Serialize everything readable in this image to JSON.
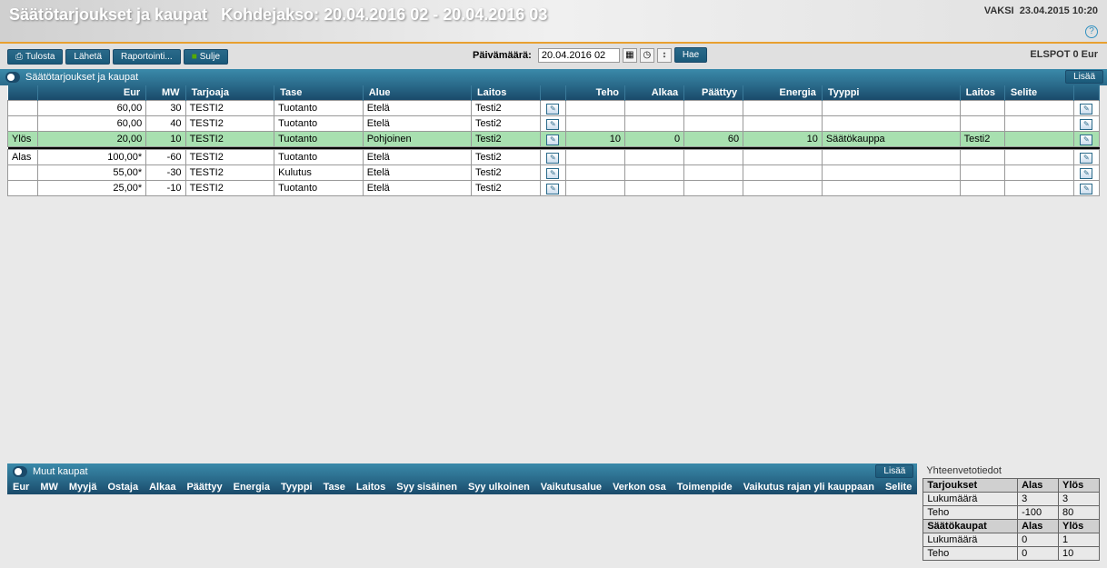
{
  "header": {
    "title": "Säätötarjoukset ja kaupat",
    "period_label": "Kohdejakso: 20.04.2016 02 - 20.04.2016 03",
    "app_label": "VAKSI",
    "timestamp": "23.04.2015 10:20"
  },
  "toolbar": {
    "print": "Tulosta",
    "send": "Lähetä",
    "report": "Raportointi...",
    "close": "Sulje",
    "date_label": "Päivämäärä:",
    "date_value": "20.04.2016 02",
    "search": "Hae",
    "elspot": "ELSPOT 0 Eur"
  },
  "panel1": {
    "title": "Säätötarjoukset ja kaupat",
    "add": "Lisää",
    "columns": [
      "",
      "Eur",
      "MW",
      "Tarjoaja",
      "Tase",
      "Alue",
      "Laitos",
      "",
      "Teho",
      "Alkaa",
      "Päättyy",
      "Energia",
      "Tyyppi",
      "Laitos",
      "Selite",
      ""
    ],
    "rows": [
      {
        "c0": "",
        "eur": "60,00",
        "mw": "30",
        "tarjoaja": "TESTI2",
        "tase": "Tuotanto",
        "alue": "Etelä",
        "laitos": "Testi2",
        "teho": "",
        "alkaa": "",
        "paattyy": "",
        "energia": "",
        "tyyppi": "",
        "laitos2": "",
        "selite": "",
        "hl": false
      },
      {
        "c0": "",
        "eur": "60,00",
        "mw": "40",
        "tarjoaja": "TESTI2",
        "tase": "Tuotanto",
        "alue": "Etelä",
        "laitos": "Testi2",
        "teho": "",
        "alkaa": "",
        "paattyy": "",
        "energia": "",
        "tyyppi": "",
        "laitos2": "",
        "selite": "",
        "hl": false
      },
      {
        "c0": "Ylös",
        "eur": "20,00",
        "mw": "10",
        "tarjoaja": "TESTI2",
        "tase": "Tuotanto",
        "alue": "Pohjoinen",
        "laitos": "Testi2",
        "teho": "10",
        "alkaa": "0",
        "paattyy": "60",
        "energia": "10",
        "tyyppi": "Säätökauppa",
        "laitos2": "Testi2",
        "selite": "",
        "hl": true
      },
      {
        "divider": true
      },
      {
        "c0": "Alas",
        "eur": "100,00*",
        "mw": "-60",
        "tarjoaja": "TESTI2",
        "tase": "Tuotanto",
        "alue": "Etelä",
        "laitos": "Testi2",
        "teho": "",
        "alkaa": "",
        "paattyy": "",
        "energia": "",
        "tyyppi": "",
        "laitos2": "",
        "selite": "",
        "hl": false
      },
      {
        "c0": "",
        "eur": "55,00*",
        "mw": "-30",
        "tarjoaja": "TESTI2",
        "tase": "Kulutus",
        "alue": "Etelä",
        "laitos": "Testi2",
        "teho": "",
        "alkaa": "",
        "paattyy": "",
        "energia": "",
        "tyyppi": "",
        "laitos2": "",
        "selite": "",
        "hl": false
      },
      {
        "c0": "",
        "eur": "25,00*",
        "mw": "-10",
        "tarjoaja": "TESTI2",
        "tase": "Tuotanto",
        "alue": "Etelä",
        "laitos": "Testi2",
        "teho": "",
        "alkaa": "",
        "paattyy": "",
        "energia": "",
        "tyyppi": "",
        "laitos2": "",
        "selite": "",
        "hl": false
      }
    ]
  },
  "panel2": {
    "title": "Muut kaupat",
    "add": "Lisää",
    "columns": [
      "Eur",
      "MW",
      "Myyjä",
      "Ostaja",
      "Alkaa",
      "Päättyy",
      "Energia",
      "Tyyppi",
      "Tase",
      "Laitos",
      "Syy sisäinen",
      "Syy ulkoinen",
      "Vaikutusalue",
      "Verkon osa",
      "Toimenpide",
      "Vaikutus rajan yli kauppaan",
      "Selite"
    ]
  },
  "summary": {
    "title": "Yhteenvetotiedot",
    "sections": [
      {
        "head": "Tarjoukset",
        "c1": "Alas",
        "c2": "Ylös",
        "rows": [
          {
            "l": "Lukumäärä",
            "a": "3",
            "y": "3"
          },
          {
            "l": "Teho",
            "a": "-100",
            "y": "80"
          }
        ]
      },
      {
        "head": "Säätökaupat",
        "c1": "Alas",
        "c2": "Ylös",
        "rows": [
          {
            "l": "Lukumäärä",
            "a": "0",
            "y": "1"
          },
          {
            "l": "Teho",
            "a": "0",
            "y": "10"
          }
        ]
      }
    ]
  }
}
